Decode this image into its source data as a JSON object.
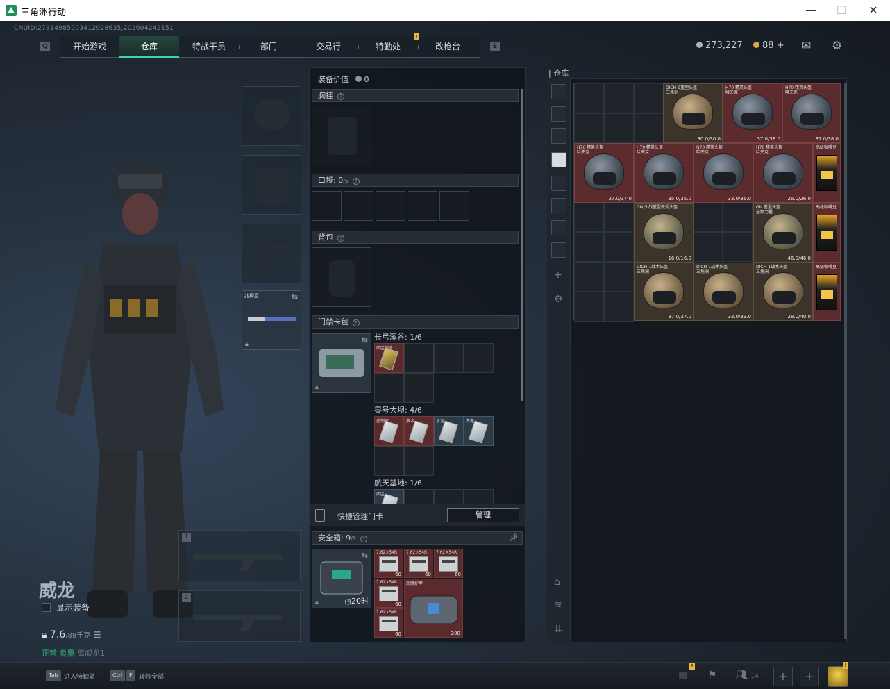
{
  "window": {
    "title": "三角洲行动",
    "minimize": "—",
    "maximize": "☐",
    "close": "✕"
  },
  "cnuid": "CNUID:273149859034129286​35,2026042421​51",
  "nav": {
    "left_key": "Q",
    "right_key": "E",
    "tabs": [
      "开始游戏",
      "仓库",
      "特战干员",
      "部门",
      "交易行",
      "特勤处",
      "改枪台"
    ],
    "active": "仓库",
    "badge": "!"
  },
  "currency": {
    "silver": "273,227",
    "gold": "88",
    "plus": "+"
  },
  "operator": {
    "name": "威龙",
    "show_equip": "显示装备",
    "weight": "7.6",
    "weight_unit": "/88千克",
    "status_a": "正常",
    "status_b": "负重",
    "status_c": "离威龙1"
  },
  "left_slots": {
    "gun_label": "兆椅屋"
  },
  "weapon_slots": [
    "1",
    "2"
  ],
  "center": {
    "value_label": "装备价值",
    "value": "0",
    "chest": "胸挂",
    "pocket": "口袋:",
    "pocket_count": "0",
    "pocket_max": "/5",
    "backpack": "背包",
    "keycard": "门禁卡包",
    "maps": [
      {
        "name": "长弓溪谷:",
        "count": "1/6",
        "item": "西区宿舍"
      },
      {
        "name": "零号大坝:",
        "count": "4/6",
        "items": [
          "控制室",
          "技术",
          "水泥",
          "变电"
        ]
      },
      {
        "name": "航天基地:",
        "count": "1/6",
        "item": "西区"
      }
    ],
    "quick_manage": "快捷管理门卡",
    "manage_btn": "管理",
    "safe": "安全箱:",
    "safe_count": "9",
    "safe_max": "/9",
    "safe_timer": "20时",
    "ammo_label": "7.62×54R",
    "ammo_count": "60",
    "ammo_count2": "60",
    "pack_label": "高级护甲",
    "pack_count": "200"
  },
  "storage": {
    "title": "仓库",
    "items": [
      {
        "name": "DICH-9重型头盔\n三角洲",
        "dur": "30.0/30.0",
        "tone": "tan"
      },
      {
        "name": "H70 精英头盔\n哈夫克",
        "dur": "37.0/38.0",
        "tone": "red"
      },
      {
        "name": "H70 精英头盔\n哈夫克",
        "dur": "37.0/38.0",
        "tone": "red"
      },
      {
        "name": "H70 精英头盔\n哈夫克",
        "dur": "37.0/37.0",
        "tone": "red"
      },
      {
        "name": "H70 精英头盔\n哈夫克",
        "dur": "35.0/35.0",
        "tone": "red"
      },
      {
        "name": "H70 精英头盔\n哈夫克",
        "dur": "33.0/36.0",
        "tone": "red"
      },
      {
        "name": "H70 精英头盔\n哈夫克",
        "dur": "26.0/26.0",
        "tone": "red"
      },
      {
        "name": "高级咖啡豆",
        "dur": "",
        "tone": "red"
      },
      {
        "name": "GN 久战重型夜视头盔",
        "dur": "16.0/16.0",
        "tone": "tan"
      },
      {
        "name": "GN 重型头盔\n全频力量",
        "dur": "46.0/46.0",
        "tone": "tan"
      },
      {
        "name": "高级咖啡豆",
        "dur": "",
        "tone": "red"
      },
      {
        "name": "DICH-1战术头盔\n三角洲",
        "dur": "37.0/37.0",
        "tone": "tan"
      },
      {
        "name": "DICH-1战术头盔\n三角洲",
        "dur": "33.0/33.0",
        "tone": "tan"
      },
      {
        "name": "DICH-1战术头盔\n三角洲",
        "dur": "28.0/40.0",
        "tone": "tan"
      },
      {
        "name": "高级咖啡豆",
        "dur": "",
        "tone": "red"
      }
    ]
  },
  "bottom": {
    "tab_key": "Tab",
    "tab_label": "进入特勤处",
    "ctrl_key": "Ctrl",
    "f_key": "F",
    "f_label": "转移全部",
    "friends": "14",
    "badge": "!"
  },
  "colors": {
    "accent": "#3fd6a3",
    "item_red": "#5c2b2d",
    "item_tan": "#3c342a"
  }
}
